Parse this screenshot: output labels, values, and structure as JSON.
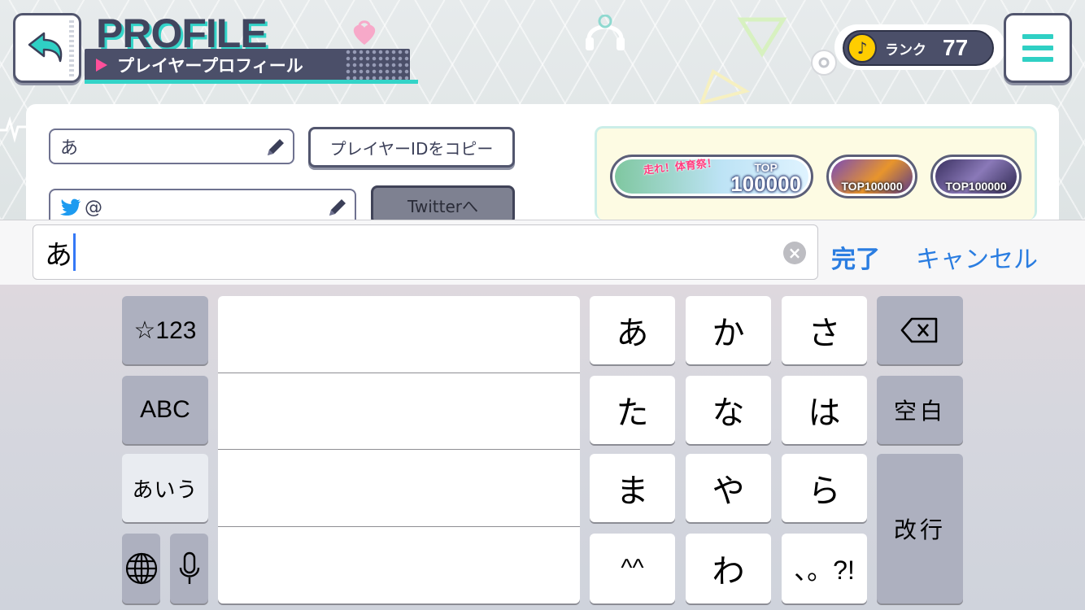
{
  "header": {
    "title": "PROFILE",
    "subtitle": "プレイヤープロフィール",
    "rank_label": "ランク",
    "rank_value": "77"
  },
  "profile": {
    "name_value": "あ",
    "twitter_prefix": "@",
    "copy_id_button": "プレイヤーIDをコピー",
    "twitter_button": "Twitterへ"
  },
  "achievements": [
    {
      "banner_text": "走れ！体育祭！",
      "top_label": "TOP",
      "top_value": "100000"
    },
    {
      "top_label": "TOP100000"
    },
    {
      "top_label": "TOP100000"
    }
  ],
  "input_bar": {
    "text_value": "あ",
    "done_label": "完了",
    "cancel_label": "キャンセル"
  },
  "keyboard": {
    "mode_symbols": "☆123",
    "mode_abc": "ABC",
    "mode_kana": "あいう",
    "keys": [
      "あ",
      "か",
      "さ",
      "た",
      "な",
      "は",
      "ま",
      "や",
      "ら",
      "^^",
      "わ",
      "、。?!"
    ],
    "space_label": "空白",
    "return_label": "改行"
  },
  "colors": {
    "accent_teal": "#33d4c8",
    "panel_navy": "#4b4f69",
    "ios_blue": "#2a7de1",
    "caret_blue": "#3478f6"
  }
}
